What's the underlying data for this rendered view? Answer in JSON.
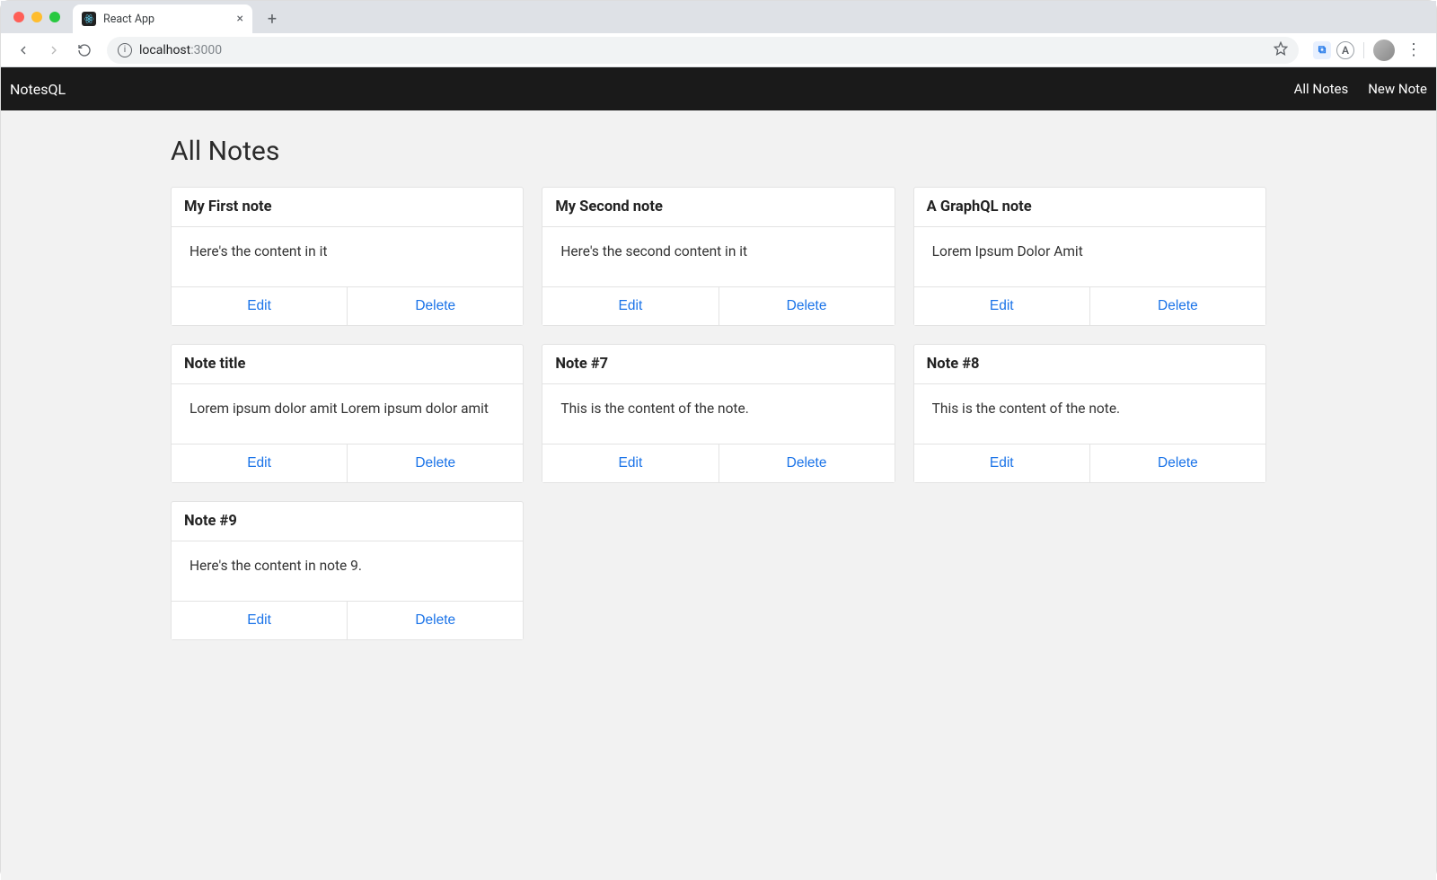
{
  "browser": {
    "tab_title": "React App",
    "url_host": "localhost",
    "url_port": ":3000"
  },
  "navbar": {
    "brand": "NotesQL",
    "links": [
      {
        "label": "All Notes"
      },
      {
        "label": "New Note"
      }
    ]
  },
  "page": {
    "title": "All Notes",
    "actions": {
      "edit": "Edit",
      "delete": "Delete"
    }
  },
  "notes": [
    {
      "title": "My First note",
      "content": "Here's the content in it"
    },
    {
      "title": "My Second note",
      "content": "Here's the second content in it"
    },
    {
      "title": "A GraphQL note",
      "content": "Lorem Ipsum Dolor Amit"
    },
    {
      "title": "Note title",
      "content": "Lorem ipsum dolor amit Lorem ipsum dolor amit"
    },
    {
      "title": "Note #7",
      "content": "This is the content of the note."
    },
    {
      "title": "Note #8",
      "content": "This is the content of the note."
    },
    {
      "title": "Note #9",
      "content": "Here's the content in note 9."
    }
  ]
}
